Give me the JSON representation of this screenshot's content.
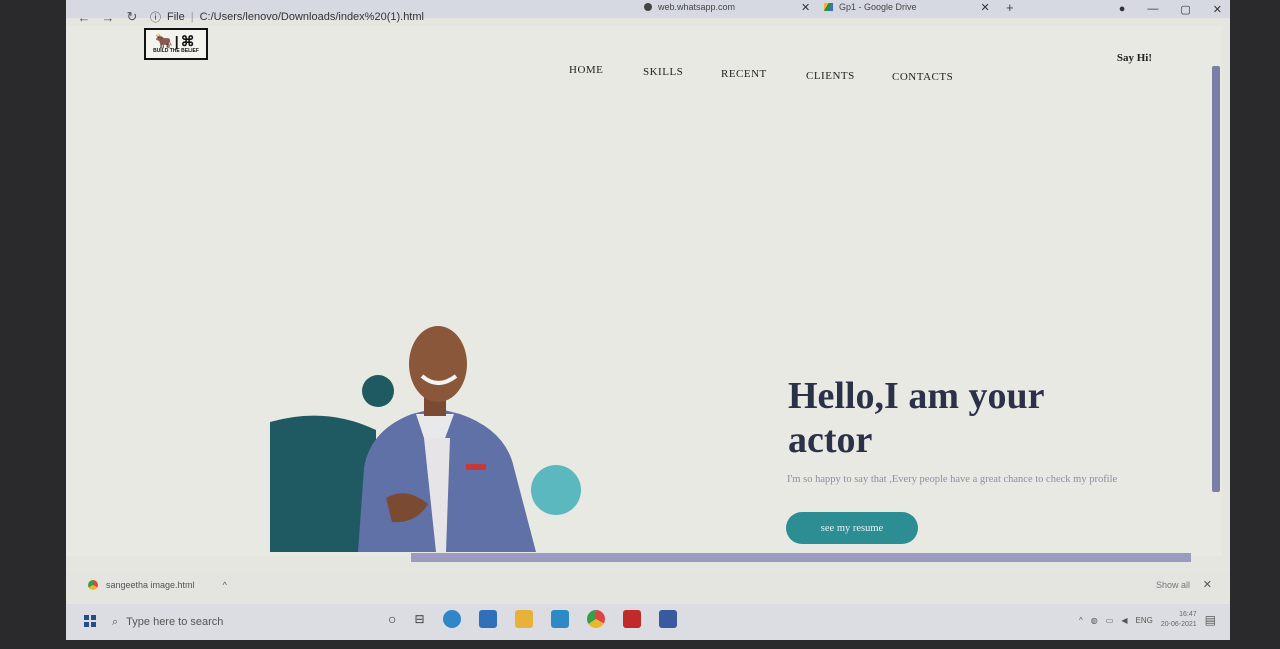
{
  "browser": {
    "tabs": [
      {
        "label": "web.whatsapp.com"
      },
      {
        "label": "Gp1 - Google Drive"
      }
    ],
    "new_tab_symbol": "+",
    "file_label": "File",
    "url": "C:/Users/lenovo/Downloads/index%20(1).html"
  },
  "site": {
    "logo_mark": "🐂|⌘",
    "logo_tagline": "BUILD THE BELIEF",
    "nav": [
      "HOME",
      "SKILLS",
      "RECENT",
      "CLIENTS",
      "CONTACTS"
    ],
    "say_hi": "Say Hi!",
    "headline": "Hello,I am your actor",
    "subtext": "I'm so happy to say that ,Every people have a great chance to check my profile",
    "cta": "see my resume",
    "colors": {
      "accent": "#2c8d93",
      "heading": "#2b3148",
      "blob": "#1f5a63",
      "circle": "#5bb8be"
    }
  },
  "downloads": {
    "file": "sangeetha image.html",
    "show_all": "Show all"
  },
  "taskbar": {
    "search_placeholder": "Type here to search",
    "lang": "ENG",
    "time": "16:47",
    "date": "20-06-2021"
  }
}
